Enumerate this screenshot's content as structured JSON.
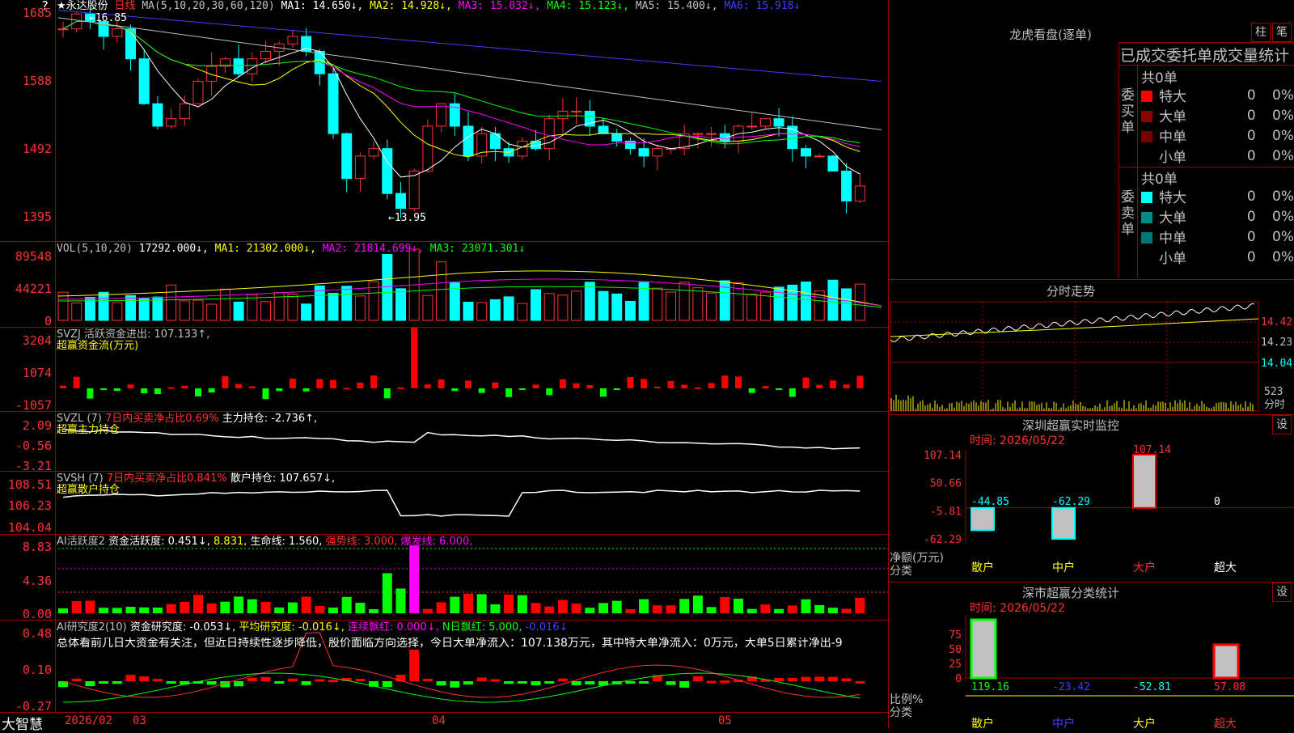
{
  "app": {
    "brand": "大智慧",
    "corner": "?"
  },
  "header": {
    "stock": "★永达股份",
    "period": "日线",
    "ma": [
      {
        "text": "MA(5,10,20,30,60,120)",
        "color": "#c0c0c0"
      },
      {
        "text": "MA1: 14.650↓,",
        "color": "#ffffff"
      },
      {
        "text": "MA2: 14.928↓,",
        "color": "#ffff00"
      },
      {
        "text": "MA3: 15.032↓,",
        "color": "#ff00ff"
      },
      {
        "text": "MA4: 15.123↓,",
        "color": "#00ff00"
      },
      {
        "text": "MA5: 15.400↓,",
        "color": "#c0c0c0"
      },
      {
        "text": "MA6: 15.918↓",
        "color": "#4040ff"
      }
    ]
  },
  "price_axis": [
    "1685",
    "1588",
    "1492",
    "1395"
  ],
  "price_annotations": {
    "high": "16.85",
    "low": "13.95"
  },
  "vol": {
    "axis": [
      "89548",
      "44221",
      "0"
    ],
    "legend": [
      {
        "text": "VOL(5,10,20)",
        "color": "#c0c0c0"
      },
      {
        "text": "17292.000↓,",
        "color": "#ffffff"
      },
      {
        "text": "MA1: 21302.000↓,",
        "color": "#ffff00"
      },
      {
        "text": "MA2: 21814.699↓,",
        "color": "#ff00ff"
      },
      {
        "text": "MA3: 23071.301↓",
        "color": "#00ff00"
      }
    ]
  },
  "svzj": {
    "axis": [
      "3204",
      "1074",
      "-1057"
    ],
    "legend": [
      {
        "text": "SVZJ  活跃资金进出: 107.133↑,",
        "color": "#c0c0c0"
      }
    ],
    "sub": "超赢资金流(万元)"
  },
  "svzl": {
    "axis": [
      "2.09",
      "-0.56",
      "-3.21"
    ],
    "legend": [
      {
        "text": "SVZL (7)",
        "color": "#c0c0c0"
      },
      {
        "text": "7日内买卖净占比0.69%",
        "color": "#ff3232"
      },
      {
        "text": "主力持仓: -2.736↑,",
        "color": "#ffffff"
      }
    ],
    "sub": "超赢主力持仓"
  },
  "svsh": {
    "axis": [
      "108.51",
      "106.23",
      "104.04"
    ],
    "legend": [
      {
        "text": "SVSH (7)",
        "color": "#c0c0c0"
      },
      {
        "text": "7日内买卖净占比0.841%",
        "color": "#ff3232"
      },
      {
        "text": "散户持仓: 107.657↓,",
        "color": "#ffffff"
      }
    ],
    "sub": "超赢散户持仓"
  },
  "ai1": {
    "axis": [
      "8.83",
      "4.36",
      "0.00"
    ],
    "legend": [
      {
        "text": "AI活跃度2",
        "color": "#c0c0c0"
      },
      {
        "text": "资金活跃度: 0.451↓,",
        "color": "#ffffff"
      },
      {
        "text": "8.831,",
        "color": "#ffff00"
      },
      {
        "text": "生命线: 1.560,",
        "color": "#ffffff"
      },
      {
        "text": "强势线: 3.000,",
        "color": "#ff3232"
      },
      {
        "text": "爆发线: 6.000,",
        "color": "#ff00ff"
      }
    ]
  },
  "ai2": {
    "axis": [
      "0.48",
      "0.10",
      "-0.27"
    ],
    "legend": [
      {
        "text": "AI研究度2(10)",
        "color": "#c0c0c0"
      },
      {
        "text": "资金研究度: -0.053↓,",
        "color": "#ffffff"
      },
      {
        "text": "平均研究度: -0.016↓,",
        "color": "#ffff00"
      },
      {
        "text": "连续飘红: 0.000↓,",
        "color": "#ff00ff"
      },
      {
        "text": "N日飘红: 5.000,",
        "color": "#00ff00"
      },
      {
        "text": "-0.016↓",
        "color": "#4040ff"
      }
    ],
    "note": "总体看前几日大资金有关注，但近日持续性逐步降低，股价面临方向选择，今日大单净流入：107.138万元，其中特大单净流入：0万元，大单5日累计净出-9"
  },
  "date_axis": [
    "2026/02",
    "03",
    "04",
    "05"
  ],
  "dragon": {
    "title": "龙虎看盘(逐单)",
    "btn1": "柱",
    "btn2": "笔",
    "header": "已成交委托单成交量统计",
    "buy_label": "委买单",
    "sell_label": "委卖单",
    "buy_total": "共0单",
    "sell_total": "共0单",
    "buy_rows": [
      {
        "name": "特大",
        "color": "#ff0000",
        "count": "0",
        "pct": "0%"
      },
      {
        "name": "大单",
        "color": "#8b0000",
        "count": "0",
        "pct": "0%"
      },
      {
        "name": "中单",
        "color": "#7a0000",
        "count": "0",
        "pct": "0%"
      },
      {
        "name": "小单",
        "color": "",
        "count": "0",
        "pct": "0%"
      }
    ],
    "sell_rows": [
      {
        "name": "特大",
        "color": "#00ffff",
        "count": "0",
        "pct": "0%"
      },
      {
        "name": "大单",
        "color": "#008b8b",
        "count": "0",
        "pct": "0%"
      },
      {
        "name": "中单",
        "color": "#007777",
        "count": "0",
        "pct": "0%"
      },
      {
        "name": "小单",
        "color": "",
        "count": "0",
        "pct": "0%"
      }
    ]
  },
  "intraday": {
    "title": "分时走势",
    "axis": [
      "14.42",
      "14.23",
      "14.04"
    ],
    "vol_label": "523",
    "vol_unit": "分时"
  },
  "sz_monitor": {
    "title": "深圳超赢实时监控",
    "btn": "设",
    "time": "时间: 2026/05/22",
    "axis": [
      "107.14",
      "50.66",
      "-5.81",
      "-62.29"
    ],
    "y_label": "净额(万元)",
    "x_label": "分类",
    "categories": [
      "散户",
      "中户",
      "大户",
      "超大"
    ]
  },
  "sz_stats": {
    "title": "深市超赢分类统计",
    "btn": "设",
    "time": "时间: 2026/05/22",
    "axis": [
      "75",
      "50",
      "25",
      "0"
    ],
    "y_label": "比例%",
    "x_label": "分类",
    "categories": [
      "散户",
      "中户",
      "大户",
      "超大"
    ]
  },
  "chart_data": [
    {
      "type": "bar",
      "name": "深圳超赢实时监控",
      "categories": [
        "散户",
        "中户",
        "大户",
        "超大"
      ],
      "values": [
        -44.85,
        -62.29,
        107.14,
        0
      ],
      "ylim": [
        -62.29,
        107.14
      ],
      "ylabel": "净额(万元)",
      "xlabel": "分类"
    },
    {
      "type": "bar",
      "name": "深市超赢分类统计",
      "categories": [
        "散户",
        "中户",
        "大户",
        "超大"
      ],
      "values": [
        119.16,
        -23.42,
        -52.81,
        57.08
      ],
      "ylim": [
        0,
        75
      ],
      "ylabel": "比例%",
      "xlabel": "分类"
    }
  ]
}
